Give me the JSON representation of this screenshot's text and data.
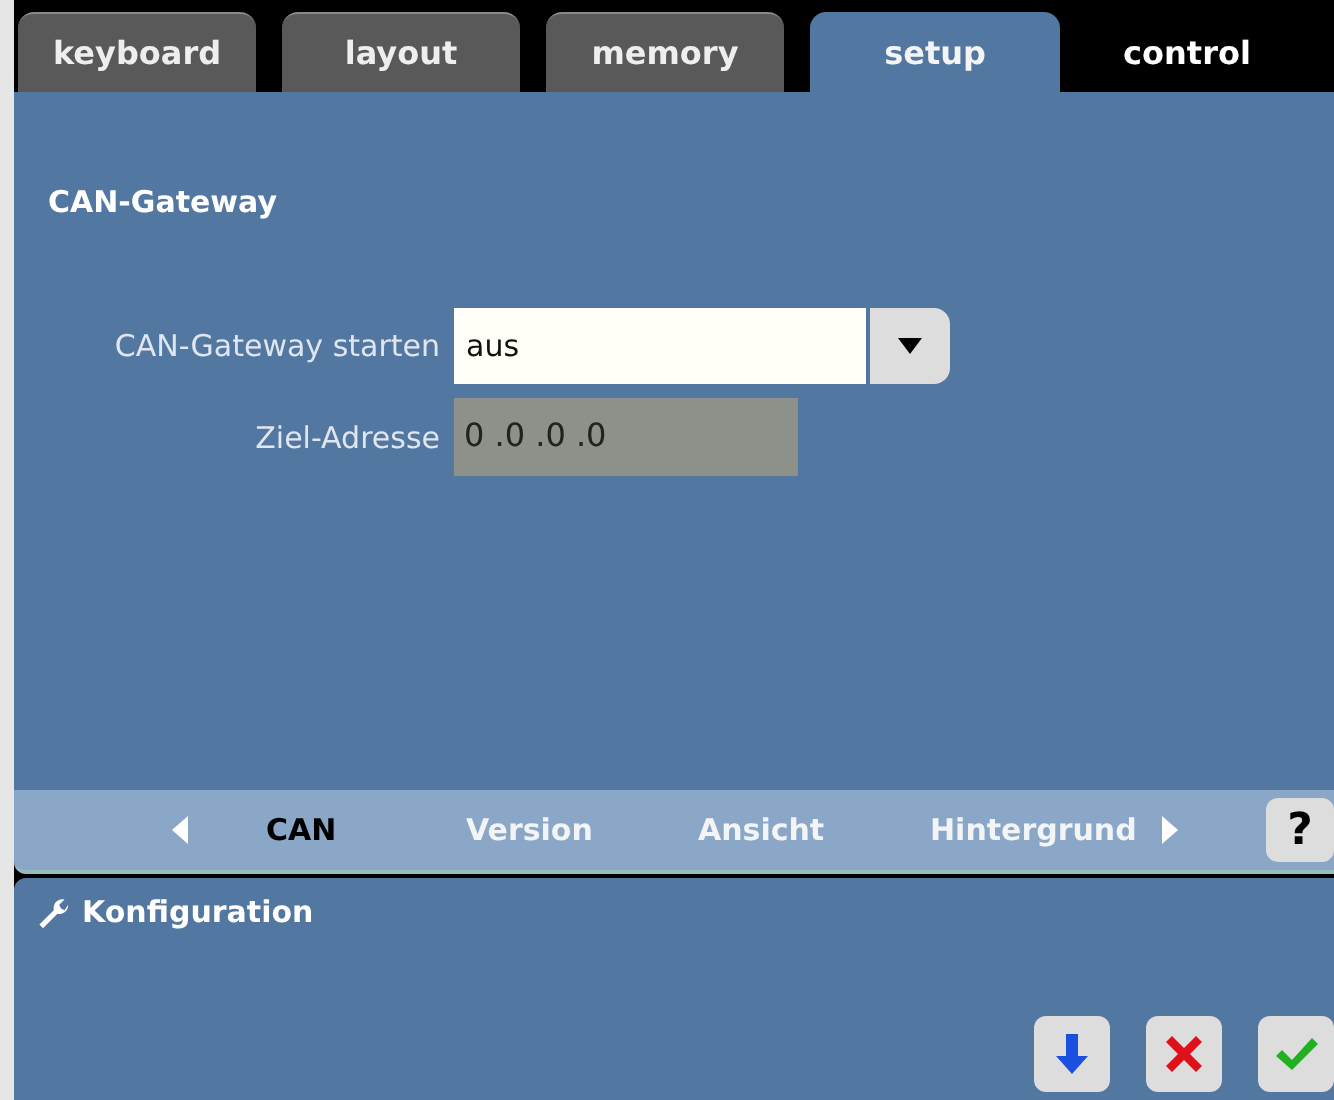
{
  "tabs": [
    {
      "label": "keyboard",
      "selected": false,
      "kind": "tab"
    },
    {
      "label": "layout",
      "selected": false,
      "kind": "tab"
    },
    {
      "label": "memory",
      "selected": false,
      "kind": "tab"
    },
    {
      "label": "setup",
      "selected": true,
      "kind": "tab"
    },
    {
      "label": "control",
      "selected": false,
      "kind": "plain"
    }
  ],
  "section_title": "CAN-Gateway",
  "fields": [
    {
      "label": "CAN-Gateway starten",
      "value": "aus",
      "kind": "dropdown",
      "disabled": false
    },
    {
      "label": "Ziel-Adresse",
      "value": "0  .0  .0  .0",
      "kind": "text",
      "disabled": true
    }
  ],
  "subtabs": [
    {
      "label": "CAN",
      "selected": true
    },
    {
      "label": "Version",
      "selected": false
    },
    {
      "label": "Ansicht",
      "selected": false
    },
    {
      "label": "Hintergrund",
      "selected": false
    }
  ],
  "help_button": "?",
  "bottom_panel": {
    "title": "Konfiguration"
  }
}
